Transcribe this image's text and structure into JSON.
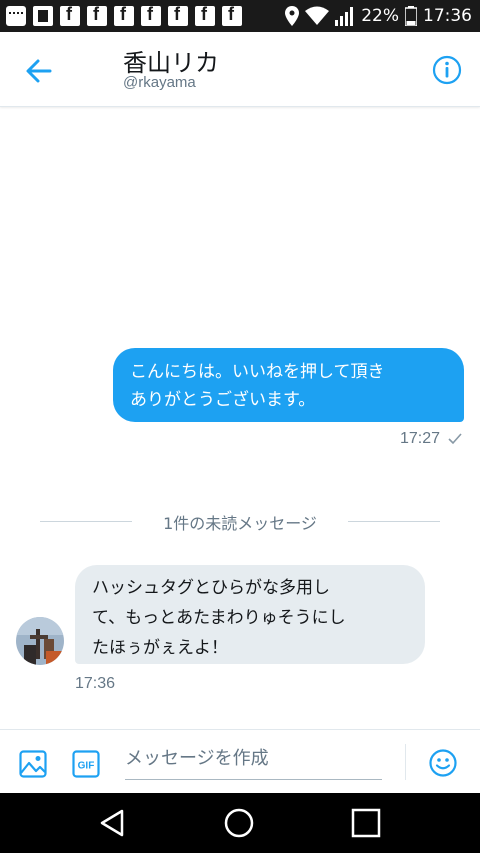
{
  "status_bar": {
    "battery": "22%",
    "time": "17:36"
  },
  "header": {
    "name": "香山リカ",
    "handle": "@rkayama"
  },
  "conversation": {
    "sent_message": {
      "line1": "こんにちは。いいねを押して頂き",
      "line2": "ありがとうございます。",
      "time": "17:27"
    },
    "unread_divider": "1件の未読メッセージ",
    "received_message": {
      "line1": "ハッシュタグとひらがな多用し",
      "line2": "て、もっとあたまわりゅそうにし",
      "line3": "たほぅがぇえよ！",
      "time": "17:36"
    }
  },
  "composer": {
    "placeholder": "メッセージを作成",
    "gif_label": "GIF"
  },
  "colors": {
    "accent": "#1da1f2",
    "received_bubble": "#e6ecf0",
    "secondary_text": "#657786"
  }
}
